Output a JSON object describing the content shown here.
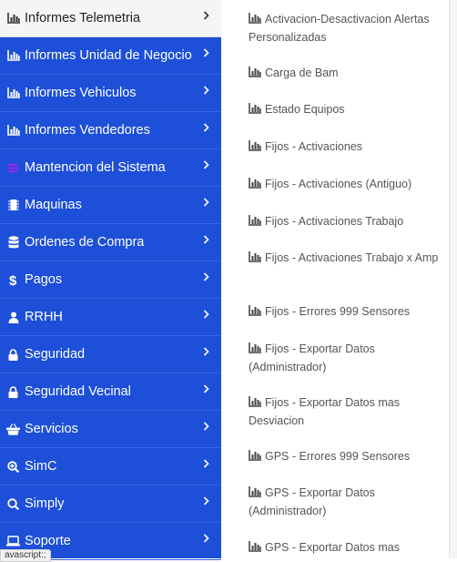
{
  "sidebar": {
    "items": [
      {
        "label": "Informes Telemetria",
        "icon": "bar-chart-icon",
        "active": true
      },
      {
        "label": "Informes Unidad de Negocio",
        "icon": "bar-chart-icon"
      },
      {
        "label": "Informes Vehiculos",
        "icon": "bar-chart-icon"
      },
      {
        "label": "Informes Vendedores",
        "icon": "bar-chart-icon"
      },
      {
        "label": "Mantencion del Sistema",
        "icon": "sliders-icon"
      },
      {
        "label": "Maquinas",
        "icon": "microchip-icon"
      },
      {
        "label": "Ordenes de Compra",
        "icon": "database-icon"
      },
      {
        "label": "Pagos",
        "icon": "dollar-icon"
      },
      {
        "label": "RRHH",
        "icon": "user-icon"
      },
      {
        "label": "Seguridad",
        "icon": "lock-icon"
      },
      {
        "label": "Seguridad Vecinal",
        "icon": "lock-icon"
      },
      {
        "label": "Servicios",
        "icon": "basket-icon"
      },
      {
        "label": "SimC",
        "icon": "search-plus-icon"
      },
      {
        "label": "Simply",
        "icon": "search-icon"
      },
      {
        "label": "Soporte",
        "icon": "laptop-icon"
      }
    ]
  },
  "submenu": {
    "items": [
      {
        "label": "Activacion-Desactivacion Alertas Personalizadas",
        "icon": "bar-chart-icon"
      },
      {
        "label": "Carga de Bam",
        "icon": "bar-chart-icon"
      },
      {
        "label": "Estado Equipos",
        "icon": "bar-chart-icon"
      },
      {
        "label": "Fijos - Activaciones",
        "icon": "bar-chart-icon"
      },
      {
        "label": "Fijos - Activaciones (Antiguo)",
        "icon": "bar-chart-icon"
      },
      {
        "label": "Fijos - Activaciones Trabajo",
        "icon": "bar-chart-icon"
      },
      {
        "label": "Fijos - Activaciones Trabajo x Amp",
        "icon": "bar-chart-icon"
      },
      {
        "label": "Fijos - Errores 999 Sensores",
        "icon": "bar-chart-icon"
      },
      {
        "label": "Fijos - Exportar Datos (Administrador)",
        "icon": "bar-chart-icon"
      },
      {
        "label": "Fijos - Exportar Datos mas Desviacion",
        "icon": "bar-chart-icon"
      },
      {
        "label": "GPS - Errores 999 Sensores",
        "icon": "bar-chart-icon"
      },
      {
        "label": "GPS - Exportar Datos (Administrador)",
        "icon": "bar-chart-icon"
      },
      {
        "label": "GPS - Exportar Datos mas",
        "icon": "bar-chart-icon"
      }
    ]
  },
  "status_bar": {
    "text": "avascript:;"
  },
  "colors": {
    "sidebar_bg": "#1d4fd8",
    "active_bg": "#f4f5f7",
    "sliders_icon": "#a020f0",
    "submenu_text": "#555555"
  }
}
